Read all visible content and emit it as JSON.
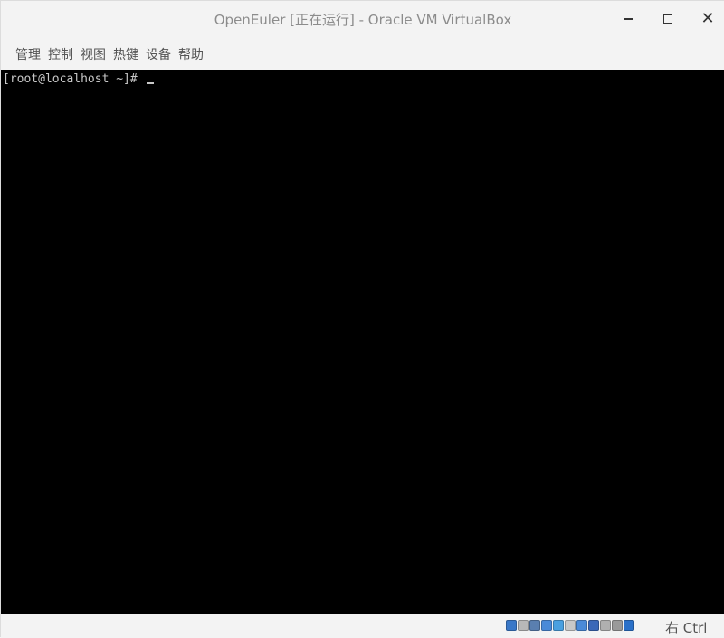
{
  "window": {
    "title": "OpenEuler [正在运行] - Oracle VM VirtualBox"
  },
  "menubar": {
    "items": [
      {
        "label": "管理"
      },
      {
        "label": "控制"
      },
      {
        "label": "视图"
      },
      {
        "label": "热键"
      },
      {
        "label": "设备"
      },
      {
        "label": "帮助"
      }
    ]
  },
  "console": {
    "prompt": "[root@localhost ~]# "
  },
  "statusbar": {
    "host_key": "右 Ctrl",
    "icons": [
      {
        "name": "hard-disk-icon",
        "color": "#3a78c8"
      },
      {
        "name": "optical-drive-icon",
        "color": "#b8b8b8"
      },
      {
        "name": "audio-icon",
        "color": "#5a7fb0"
      },
      {
        "name": "network-icon",
        "color": "#4a8ad8"
      },
      {
        "name": "usb-icon",
        "color": "#4aa0e0"
      },
      {
        "name": "shared-folders-icon",
        "color": "#c8c8c8"
      },
      {
        "name": "display-icon",
        "color": "#4a8ad8"
      },
      {
        "name": "video-capture-icon",
        "color": "#3a68b8"
      },
      {
        "name": "mouse-integration-icon",
        "color": "#b0b0b0"
      },
      {
        "name": "cpu-icon",
        "color": "#9a9a9a"
      },
      {
        "name": "keyboard-capture-icon",
        "color": "#2a70c8"
      }
    ]
  }
}
